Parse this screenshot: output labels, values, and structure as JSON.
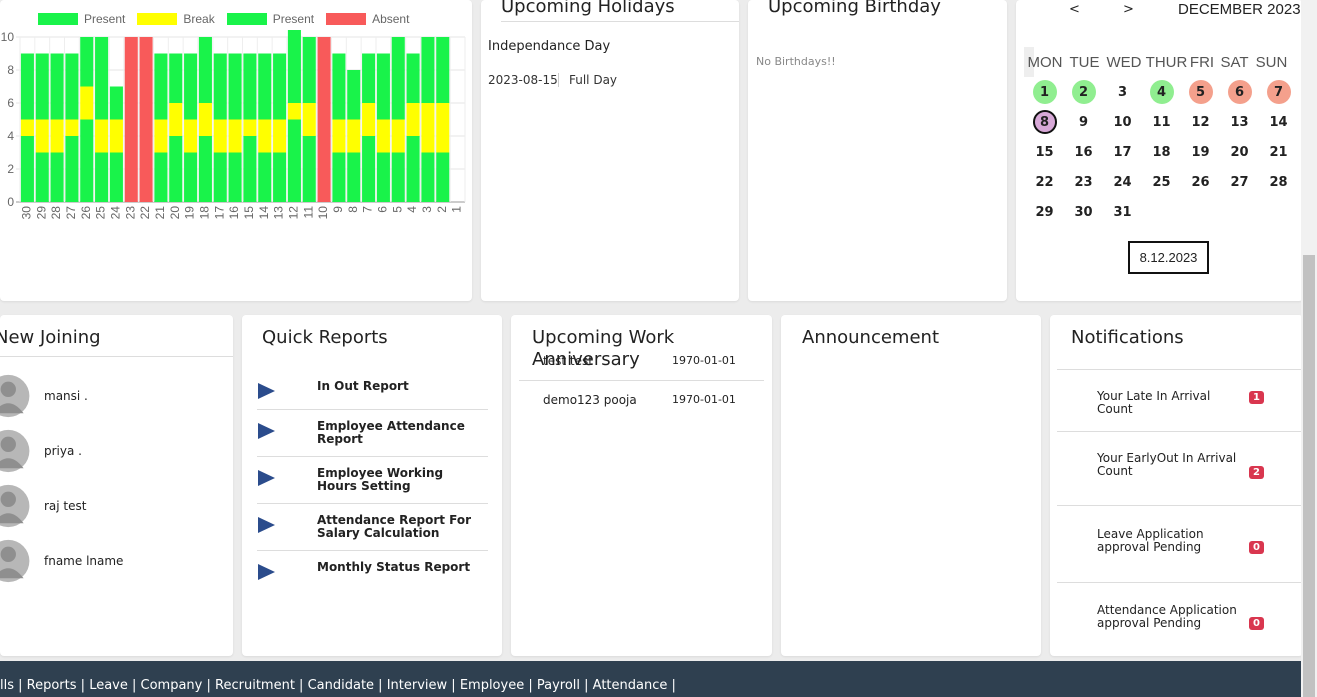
{
  "chart_data": {
    "type": "bar",
    "stacked": true,
    "legend": [
      {
        "label": "Present",
        "color": "#19f34a"
      },
      {
        "label": "Break",
        "color": "#ffff00"
      },
      {
        "label": "Present",
        "color": "#19f34a"
      },
      {
        "label": "Absent",
        "color": "#f85a5a"
      }
    ],
    "categories": [
      "30",
      "29",
      "28",
      "27",
      "26",
      "25",
      "24",
      "23",
      "22",
      "21",
      "20",
      "19",
      "18",
      "17",
      "16",
      "15",
      "14",
      "13",
      "12",
      "11",
      "10",
      "9",
      "8",
      "7",
      "6",
      "5",
      "4",
      "3",
      "2",
      "1"
    ],
    "series": [
      {
        "name": "Present",
        "values": [
          4,
          3,
          3,
          4,
          5,
          3,
          3,
          0,
          0,
          3,
          4,
          3,
          4,
          3,
          3,
          4,
          3,
          3,
          5,
          4,
          0,
          3,
          3,
          4,
          3,
          3,
          4,
          3,
          3,
          0
        ]
      },
      {
        "name": "Break",
        "values": [
          1,
          2,
          2,
          1,
          2,
          2,
          2,
          0,
          0,
          2,
          2,
          2,
          2,
          2,
          2,
          1,
          2,
          2,
          1,
          2,
          0,
          2,
          2,
          2,
          2,
          2,
          2,
          3,
          3,
          0
        ]
      },
      {
        "name": "Present",
        "values": [
          4,
          4,
          4,
          4,
          3,
          5,
          2,
          0,
          0,
          4,
          3,
          4,
          4,
          4,
          4,
          4,
          4,
          4,
          5,
          4,
          0,
          4,
          3,
          3,
          4,
          5,
          3,
          4,
          4,
          0
        ]
      },
      {
        "name": "Absent",
        "values": [
          0,
          0,
          0,
          0,
          0,
          0,
          0,
          10,
          10,
          0,
          0,
          0,
          0,
          0,
          0,
          0,
          0,
          0,
          0,
          0,
          10,
          0,
          0,
          0,
          0,
          0,
          0,
          0,
          0,
          0
        ]
      }
    ],
    "ylim": [
      0,
      10
    ],
    "yticks": [
      0,
      2,
      4,
      6,
      8,
      10
    ],
    "grid": true,
    "legend_placement": "top-left"
  },
  "holidays": {
    "title": "Upcoming Holidays",
    "name": "Independance Day",
    "date": "2023-08-15",
    "type": "Full Day"
  },
  "birthday": {
    "title": "Upcoming Birthday",
    "empty": "No Birthdays!!"
  },
  "calendar": {
    "prev": "<",
    "next": ">",
    "month": "DECEMBER 2023",
    "weekdays": [
      "MON",
      "TUE",
      "WED",
      "THUR",
      "FRI",
      "SAT",
      "SUN"
    ],
    "days": [
      "1",
      "2",
      "3",
      "4",
      "5",
      "6",
      "7",
      "8",
      "9",
      "10",
      "11",
      "12",
      "13",
      "14",
      "15",
      "16",
      "17",
      "18",
      "19",
      "20",
      "21",
      "22",
      "23",
      "24",
      "25",
      "26",
      "27",
      "28",
      "29",
      "30",
      "31"
    ],
    "present_color": "#90ee90",
    "absent_color": "#f4a08c",
    "today_color": "#d7a8d7",
    "selected": "8.12.2023"
  },
  "joining": {
    "title": "New Joining",
    "people": [
      "mansi .",
      "priya .",
      "raj test",
      "fname lname"
    ]
  },
  "reports": {
    "title": "Quick Reports",
    "items": [
      "In Out Report",
      "Employee Attendance Report",
      "Employee Working Hours Setting",
      "Attendance Report For Salary Calculation",
      "Monthly Status Report"
    ]
  },
  "anniversary": {
    "title": "Upcoming Work Anniversary",
    "rows": [
      {
        "name": "test test",
        "date": "1970-01-01"
      },
      {
        "name": "demo123 pooja",
        "date": "1970-01-01"
      }
    ]
  },
  "announcement": {
    "title": "Announcement"
  },
  "notifications": {
    "title": "Notifications",
    "items": [
      {
        "text": "Your Late In Arrival Count",
        "count": "1"
      },
      {
        "text": "Your EarlyOut In Arrival Count",
        "count": "2"
      },
      {
        "text": "Leave Application approval Pending",
        "count": "0"
      },
      {
        "text": "Attendance Application approval Pending",
        "count": "0"
      }
    ]
  },
  "footer": {
    "links": [
      "lls",
      "Reports",
      "Leave",
      "Company",
      "Recruitment",
      "Candidate",
      "Interview",
      "Employee",
      "Payroll",
      "Attendance"
    ]
  }
}
